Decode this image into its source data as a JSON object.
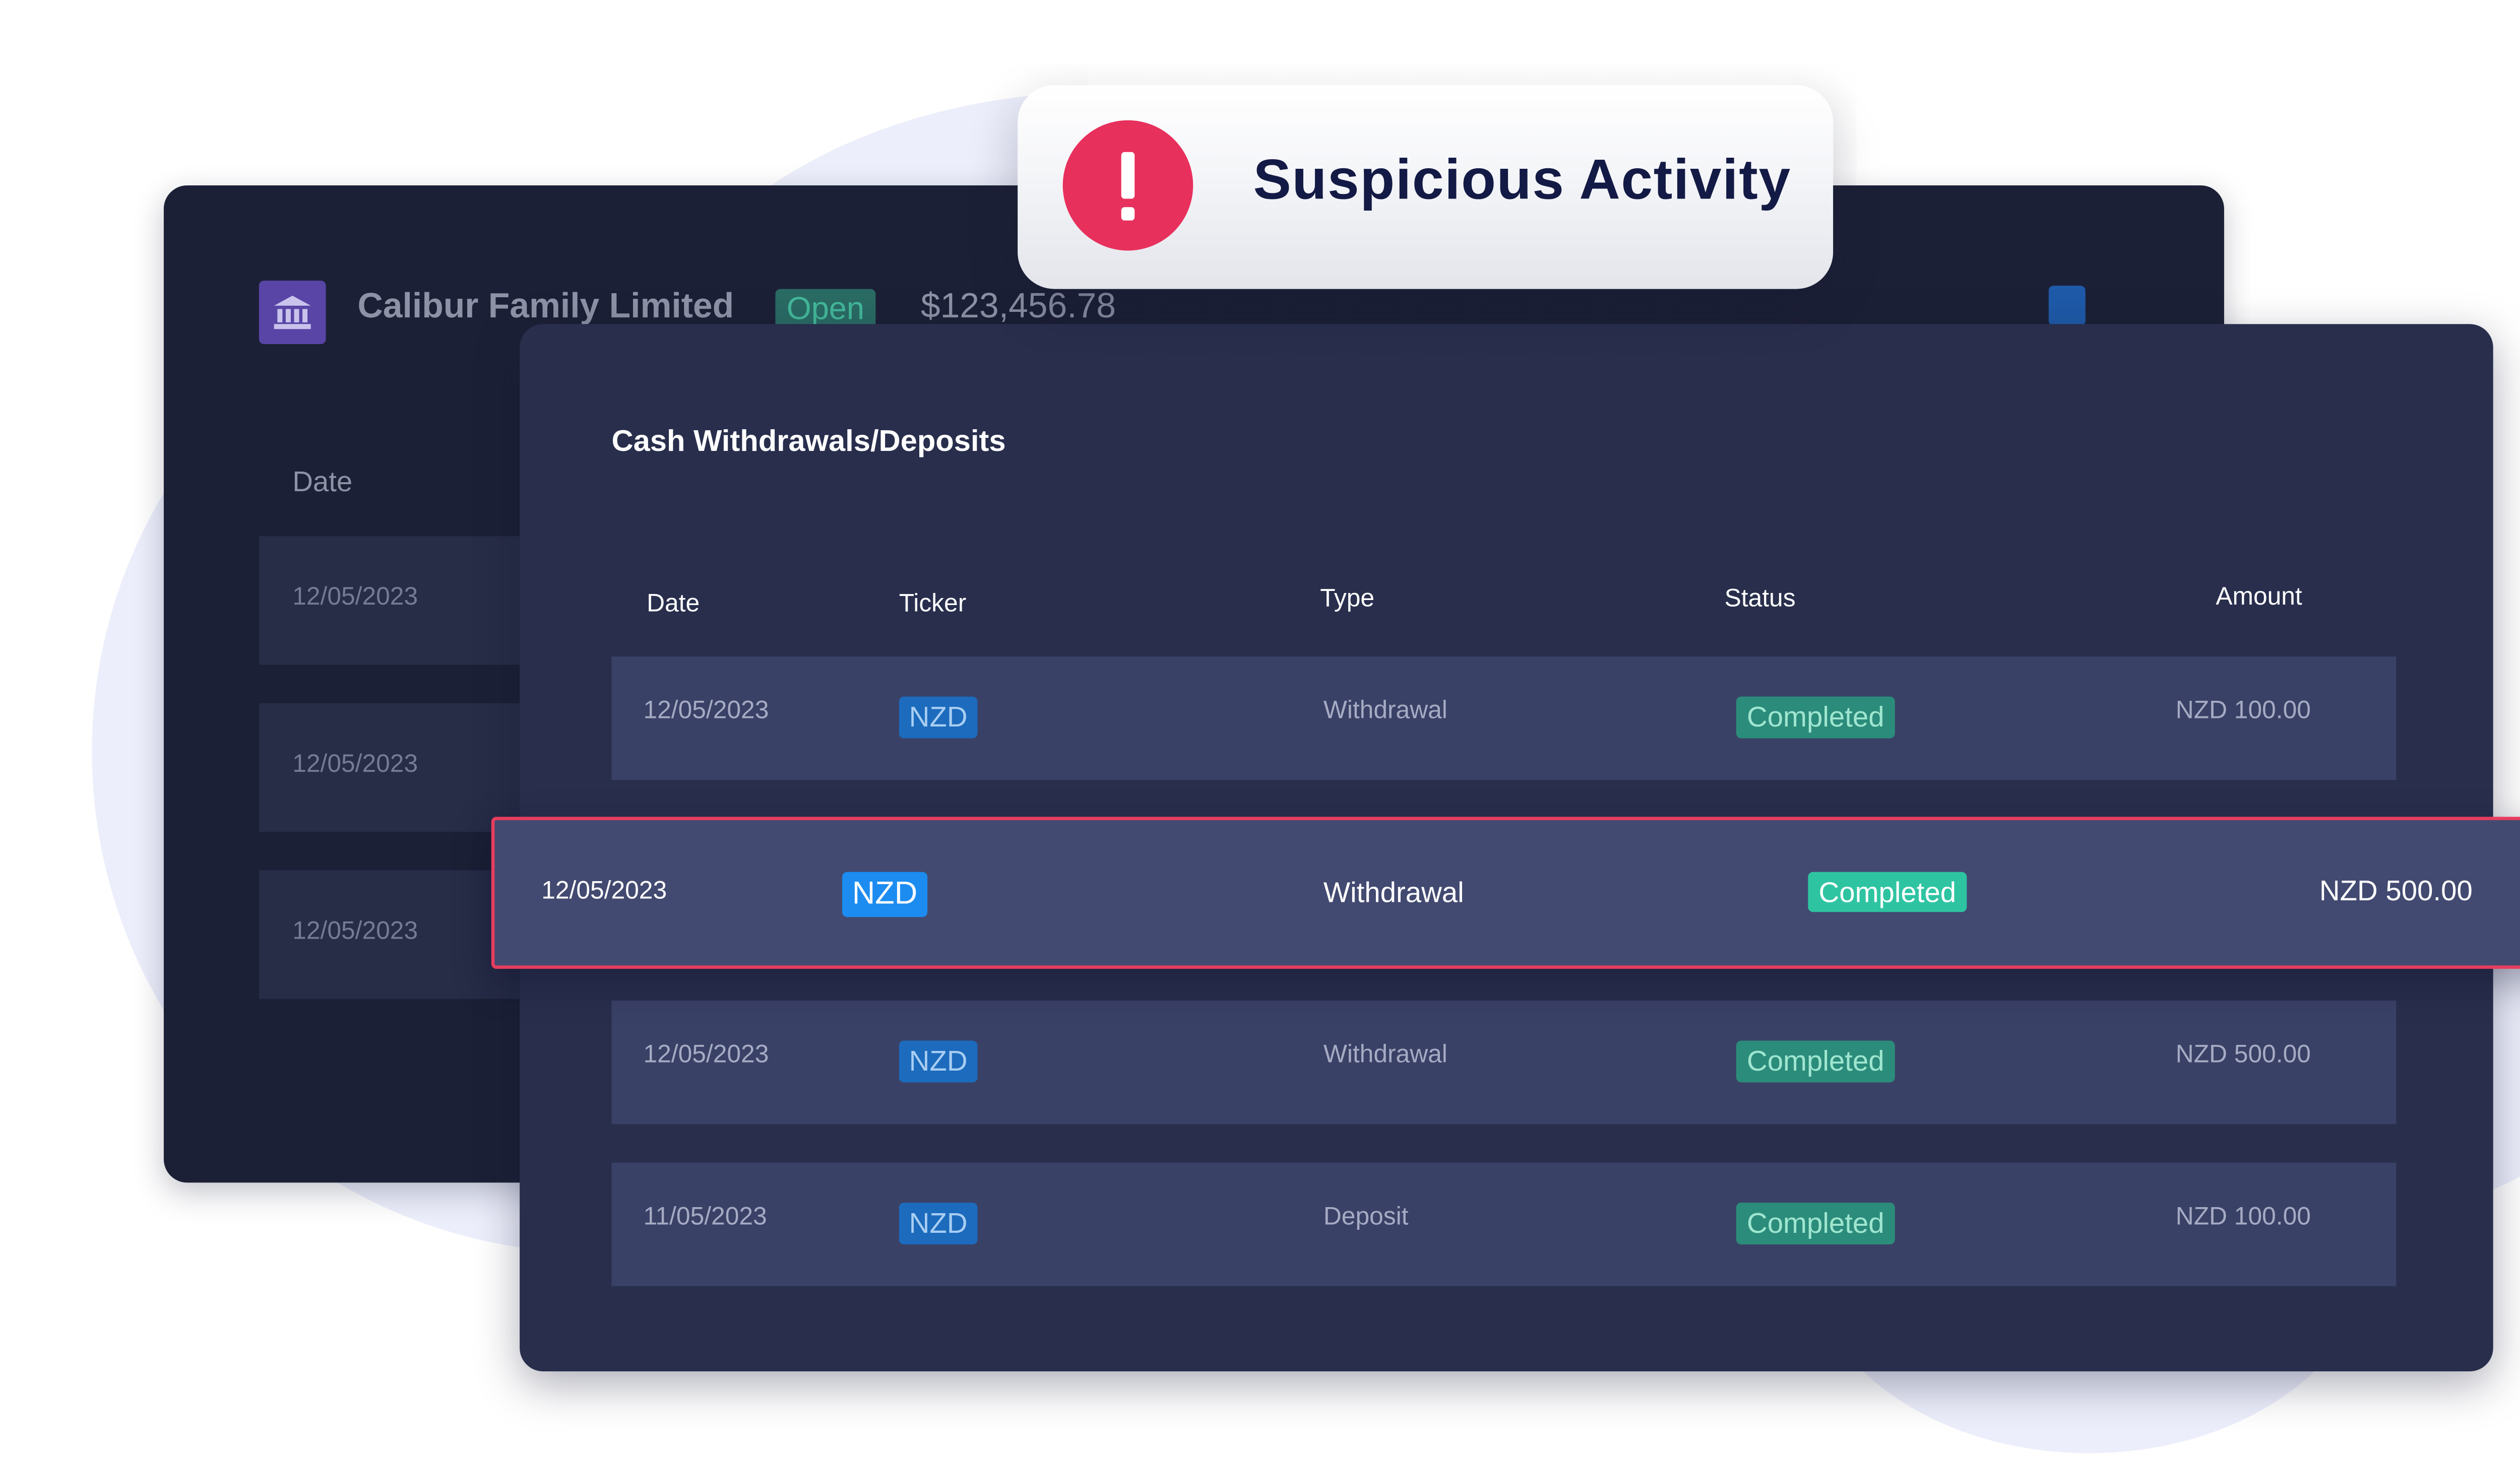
{
  "alert": {
    "icon": "exclamation-icon",
    "text": "Suspicious Activity",
    "color": "#e8305c"
  },
  "back_panel": {
    "icon": "bank-icon",
    "account_name": "Calibur Family Limited",
    "status_badge": "Open",
    "balance": "$123,456.78",
    "date_header": "Date",
    "rows": [
      "12/05/2023",
      "12/05/2023",
      "12/05/2023"
    ]
  },
  "panel": {
    "title": "Cash Withdrawals/Deposits",
    "headers": {
      "date": "Date",
      "ticker": "Ticker",
      "type": "Type",
      "status": "Status",
      "amount": "Amount"
    },
    "rows": [
      {
        "date": "12/05/2023",
        "ticker": "NZD",
        "type": "Withdrawal",
        "status": "Completed",
        "amount": "NZD 100.00"
      },
      {
        "date": "12/05/2023",
        "ticker": "NZD",
        "type": "Withdrawal",
        "status": "Completed",
        "amount": "NZD 500.00"
      },
      {
        "date": "11/05/2023",
        "ticker": "NZD",
        "type": "Deposit",
        "status": "Completed",
        "amount": "NZD 100.00"
      }
    ],
    "highlighted_row": {
      "date": "12/05/2023",
      "ticker": "NZD",
      "type": "Withdrawal",
      "status": "Completed",
      "amount": "NZD 500.00"
    }
  }
}
